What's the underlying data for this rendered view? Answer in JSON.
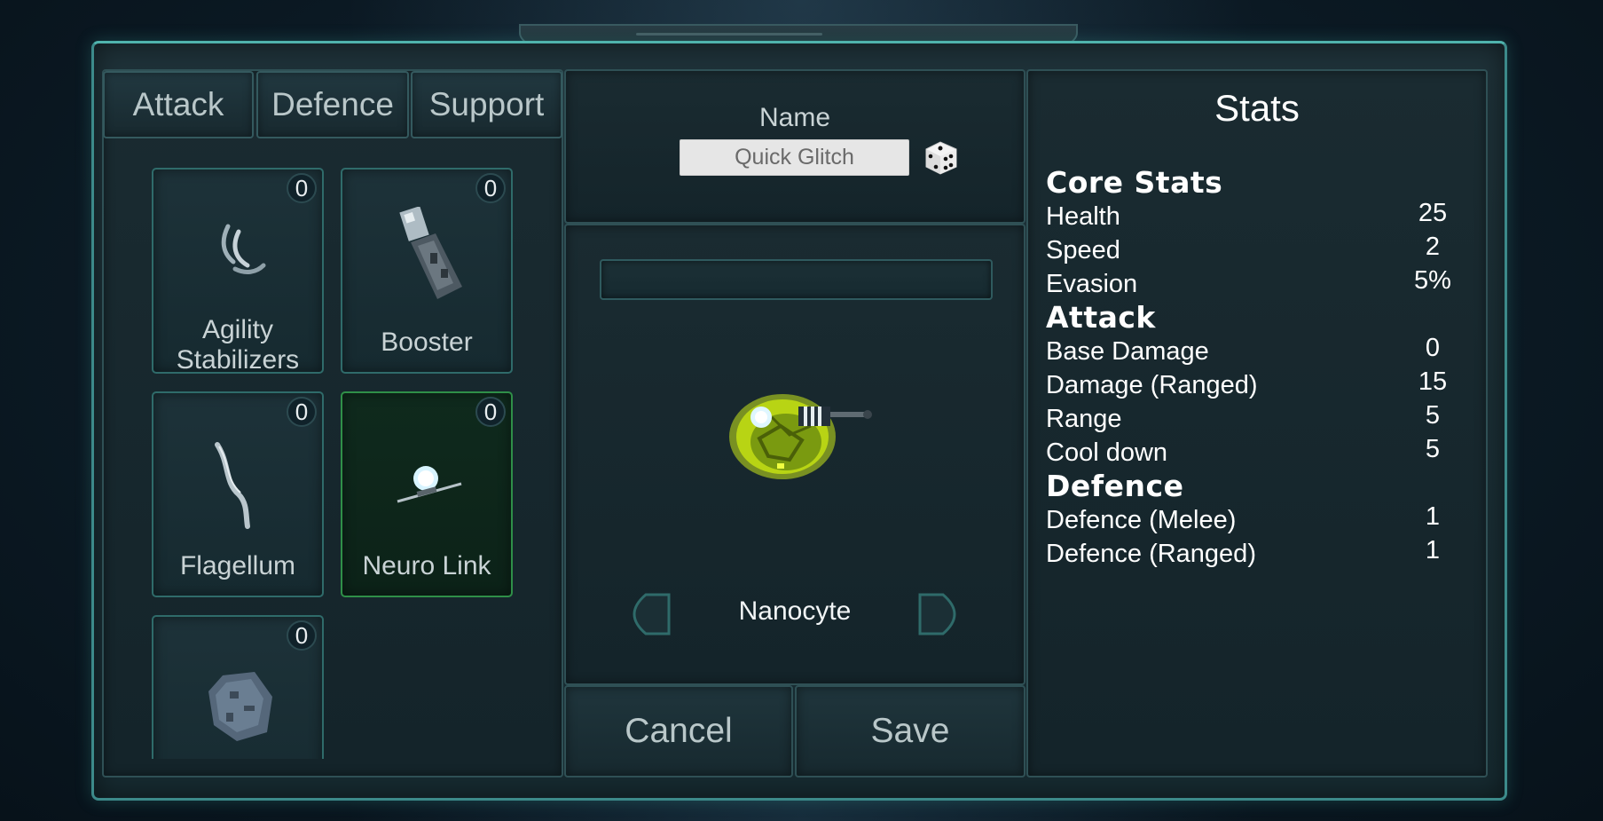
{
  "tabs": [
    {
      "label": "Attack"
    },
    {
      "label": "Defence"
    },
    {
      "label": "Support"
    }
  ],
  "items": [
    {
      "label": "Agility\nStabilizers",
      "count": "0",
      "icon": "claws-icon",
      "selected": false
    },
    {
      "label": "Booster",
      "count": "0",
      "icon": "booster-icon",
      "selected": false
    },
    {
      "label": "Flagellum",
      "count": "0",
      "icon": "flagellum-icon",
      "selected": false
    },
    {
      "label": "Neuro Link",
      "count": "0",
      "icon": "neuro-link-icon",
      "selected": true
    },
    {
      "label": "",
      "count": "0",
      "icon": "armor-plate-icon",
      "selected": false
    }
  ],
  "name_section": {
    "title": "Name",
    "input_value": "Quick Glitch",
    "dice_icon": "dice-icon"
  },
  "preview": {
    "creature_name": "Nanocyte",
    "prev_icon": "arrow-left-icon",
    "next_icon": "arrow-right-icon"
  },
  "actions": {
    "cancel_label": "Cancel",
    "save_label": "Save"
  },
  "stats": {
    "title": "Stats",
    "core": {
      "heading": "Core Stats",
      "rows": [
        {
          "label": "Health",
          "value": "25"
        },
        {
          "label": "Speed",
          "value": "2"
        },
        {
          "label": "Evasion",
          "value": "5%"
        }
      ]
    },
    "attack": {
      "heading": "Attack",
      "rows": [
        {
          "label": "Base Damage",
          "value": "0"
        },
        {
          "label": "Damage (Ranged)",
          "value": "15"
        },
        {
          "label": "Range",
          "value": "5"
        },
        {
          "label": "Cool down",
          "value": "5"
        }
      ]
    },
    "defence": {
      "heading": "Defence",
      "rows": [
        {
          "label": "Defence (Melee)",
          "value": "1"
        },
        {
          "label": "Defence (Ranged)",
          "value": "1"
        }
      ]
    }
  },
  "colors": {
    "frame_accent": "#4fb3ad",
    "selected_card": "#2f8f48",
    "creature_glow": "#d8f020"
  }
}
